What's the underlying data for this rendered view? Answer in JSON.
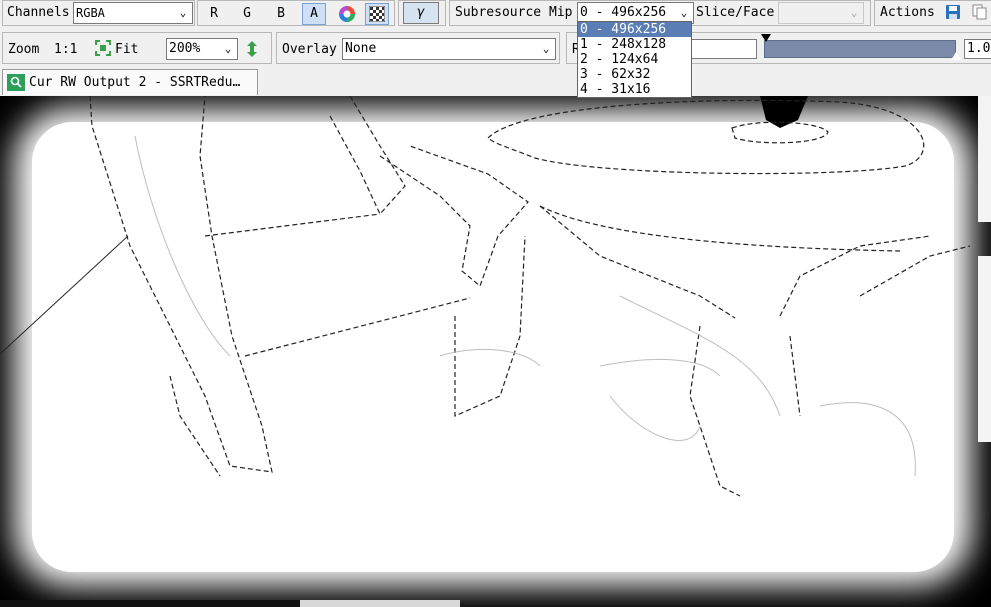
{
  "toolbar": {
    "channels_label": "Channels",
    "channels_value": "RGBA",
    "channel_r": "R",
    "channel_g": "G",
    "channel_b": "B",
    "channel_a": "A",
    "gamma_label": "γ",
    "subresource_label": "Subresource",
    "mip_label": "Mip",
    "mip_value": "0 - 496x256",
    "slice_face_label": "Slice/Face",
    "slice_face_value": "",
    "actions_label": "Actions",
    "zoom_label": "Zoom",
    "zoom_1to1": "1:1",
    "fit_label": "Fit",
    "zoom_value": "200%",
    "overlay_label": "Overlay",
    "overlay_value": "None",
    "range_start_label": "R",
    "range_end_value": "1.0"
  },
  "tab": {
    "title": "Cur RW Output 2 - SSRTRedu…"
  },
  "mip_dropdown": {
    "options": [
      "0 - 496x256",
      "1 - 248x128",
      "2 - 124x64",
      "3 - 62x32",
      "4 - 31x16"
    ],
    "selected_index": 0
  },
  "colors": {
    "accent": "#5a7db5",
    "range_bar": "#7a8aa8",
    "tab_icon": "#2e9e5b",
    "save_icon": "#2a6fc0"
  },
  "icons": {
    "color_wheel": "color-wheel-icon",
    "checkerboard": "checkerboard-icon",
    "save": "save-icon",
    "copy": "copy-icon",
    "fit": "fit-icon",
    "flip": "flip-vertical-icon",
    "tab": "texture-tab-icon"
  }
}
